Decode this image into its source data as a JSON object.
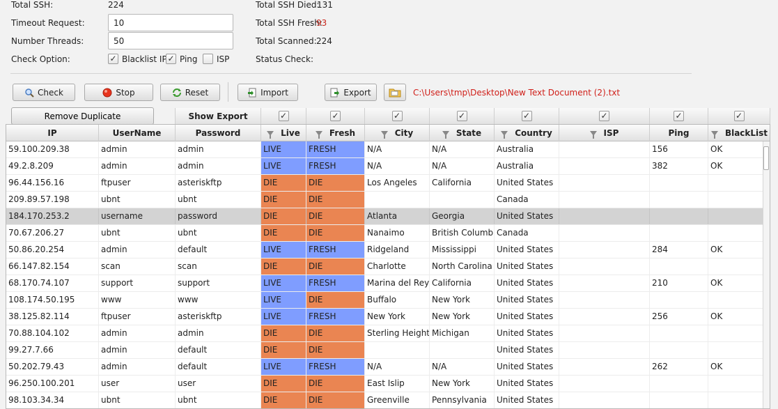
{
  "stats": {
    "total_ssh_label": "Total SSH:",
    "total_ssh_value": "224",
    "timeout_label": "Timeout Request:",
    "timeout_value": "10",
    "threads_label": "Number Threads:",
    "threads_value": "50",
    "check_option_label": "Check Option:",
    "died_label": "Total SSH Died:",
    "died_value": "131",
    "fresh_label": "Total SSH Fresh:",
    "fresh_value": "93",
    "scanned_label": "Total Scanned:",
    "scanned_value": "224",
    "status_label": "Status Check:"
  },
  "options": [
    {
      "label": "Blacklist IP",
      "checked": true
    },
    {
      "label": "Ping",
      "checked": true
    },
    {
      "label": "ISP",
      "checked": false
    }
  ],
  "toolbar": {
    "check_label": "Check",
    "stop_label": "Stop",
    "reset_label": "Reset",
    "import_label": "Import",
    "export_label": "Export",
    "file_path": "C:\\Users\\tmp\\Desktop\\New Text Document (2).txt"
  },
  "export_bar": {
    "remove_duplicate_label": "Remove Duplicate",
    "show_export_label": "Show Export",
    "check_glyph": "✓"
  },
  "columns": [
    "IP",
    "UserName",
    "Password",
    "Live",
    "Fresh",
    "City",
    "State",
    "Country",
    "ISP",
    "Ping",
    "BlackList"
  ],
  "rows": [
    {
      "ip": "59.100.209.38",
      "user": "admin",
      "pass": "admin",
      "live": "LIVE",
      "fresh": "FRESH",
      "city": "N/A",
      "state": "N/A",
      "country": "Australia",
      "isp": "",
      "ping": "156",
      "blacklist": "OK"
    },
    {
      "ip": "49.2.8.209",
      "user": "admin",
      "pass": "admin",
      "live": "LIVE",
      "fresh": "FRESH",
      "city": "N/A",
      "state": "N/A",
      "country": "Australia",
      "isp": "",
      "ping": "382",
      "blacklist": "OK"
    },
    {
      "ip": "96.44.156.16",
      "user": "ftpuser",
      "pass": "asteriskftp",
      "live": "DIE",
      "fresh": "DIE",
      "city": "Los Angeles",
      "state": "California",
      "country": "United States",
      "isp": "",
      "ping": "",
      "blacklist": ""
    },
    {
      "ip": "209.89.57.198",
      "user": "ubnt",
      "pass": "ubnt",
      "live": "DIE",
      "fresh": "DIE",
      "city": "",
      "state": "",
      "country": "Canada",
      "isp": "",
      "ping": "",
      "blacklist": ""
    },
    {
      "ip": "184.170.253.2",
      "user": "username",
      "pass": "password",
      "live": "DIE",
      "fresh": "DIE",
      "city": "Atlanta",
      "state": "Georgia",
      "country": "United States",
      "isp": "",
      "ping": "",
      "blacklist": "",
      "selected": true
    },
    {
      "ip": "70.67.206.27",
      "user": "ubnt",
      "pass": "ubnt",
      "live": "DIE",
      "fresh": "DIE",
      "city": "Nanaimo",
      "state": "British Columbia",
      "country": "Canada",
      "isp": "",
      "ping": "",
      "blacklist": ""
    },
    {
      "ip": "50.86.20.254",
      "user": "admin",
      "pass": "default",
      "live": "LIVE",
      "fresh": "FRESH",
      "city": "Ridgeland",
      "state": "Mississippi",
      "country": "United States",
      "isp": "",
      "ping": "284",
      "blacklist": "OK"
    },
    {
      "ip": "66.147.82.154",
      "user": "scan",
      "pass": "scan",
      "live": "DIE",
      "fresh": "DIE",
      "city": "Charlotte",
      "state": "North Carolina",
      "country": "United States",
      "isp": "",
      "ping": "",
      "blacklist": ""
    },
    {
      "ip": "68.170.74.107",
      "user": "support",
      "pass": "support",
      "live": "LIVE",
      "fresh": "FRESH",
      "city": "Marina del Rey",
      "state": "California",
      "country": "United States",
      "isp": "",
      "ping": "210",
      "blacklist": "OK"
    },
    {
      "ip": "108.174.50.195",
      "user": "www",
      "pass": "www",
      "live": "LIVE",
      "fresh": "DIE",
      "city": "Buffalo",
      "state": "New York",
      "country": "United States",
      "isp": "",
      "ping": "",
      "blacklist": ""
    },
    {
      "ip": "38.125.82.114",
      "user": "ftpuser",
      "pass": "asteriskftp",
      "live": "LIVE",
      "fresh": "FRESH",
      "city": "New York",
      "state": "New York",
      "country": "United States",
      "isp": "",
      "ping": "256",
      "blacklist": "OK"
    },
    {
      "ip": "70.88.104.102",
      "user": "admin",
      "pass": "admin",
      "live": "DIE",
      "fresh": "DIE",
      "city": "Sterling Heights",
      "state": "Michigan",
      "country": "United States",
      "isp": "",
      "ping": "",
      "blacklist": ""
    },
    {
      "ip": "99.27.7.66",
      "user": "admin",
      "pass": "default",
      "live": "DIE",
      "fresh": "DIE",
      "city": "",
      "state": "",
      "country": "United States",
      "isp": "",
      "ping": "",
      "blacklist": ""
    },
    {
      "ip": "50.202.79.43",
      "user": "admin",
      "pass": "default",
      "live": "LIVE",
      "fresh": "FRESH",
      "city": "N/A",
      "state": "N/A",
      "country": "United States",
      "isp": "",
      "ping": "262",
      "blacklist": "OK"
    },
    {
      "ip": "96.250.100.201",
      "user": "user",
      "pass": "user",
      "live": "DIE",
      "fresh": "DIE",
      "city": "East Islip",
      "state": "New York",
      "country": "United States",
      "isp": "",
      "ping": "",
      "blacklist": ""
    },
    {
      "ip": "98.103.34.34",
      "user": "ubnt",
      "pass": "ubnt",
      "live": "DIE",
      "fresh": "DIE",
      "city": "Greenville",
      "state": "Pennsylvania",
      "country": "United States",
      "isp": "",
      "ping": "",
      "blacklist": ""
    }
  ],
  "colors": {
    "live": "#7f9dff",
    "die": "#ea8552",
    "fresh_count": "#c8261b",
    "path": "#d0201a"
  }
}
